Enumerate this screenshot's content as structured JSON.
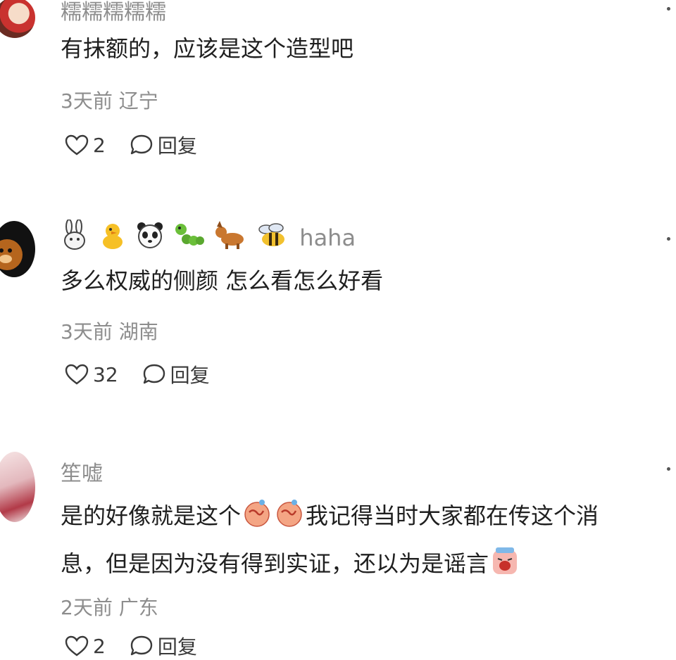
{
  "comments": [
    {
      "username": "糯糯糯糯糯",
      "text": "有抹额的，应该是这个造型吧",
      "time": "3天前",
      "location": "辽宁",
      "likes": "2",
      "reply_label": "回复"
    },
    {
      "username": "haha",
      "username_emojis": [
        "rabbit-icon",
        "chick-icon",
        "panda-icon",
        "caterpillar-icon",
        "dog-icon",
        "bee-icon"
      ],
      "text": "多么权威的侧颜 怎么看怎么好看",
      "time": "3天前",
      "location": "湖南",
      "likes": "32",
      "reply_label": "回复"
    },
    {
      "username": "笙嘘",
      "text_line1_a": "是的好像就是这个",
      "text_line1_b": "我记得当时大家都在传这个消",
      "text_line2": "息，但是因为没有得到实证，还以为是谣言",
      "time": "2天前",
      "location": "广东",
      "likes": "2",
      "reply_label": "回复"
    }
  ],
  "colors": {
    "text": "#1f1f1f",
    "meta": "#8d8d8d",
    "icon": "#3a3a3a"
  }
}
